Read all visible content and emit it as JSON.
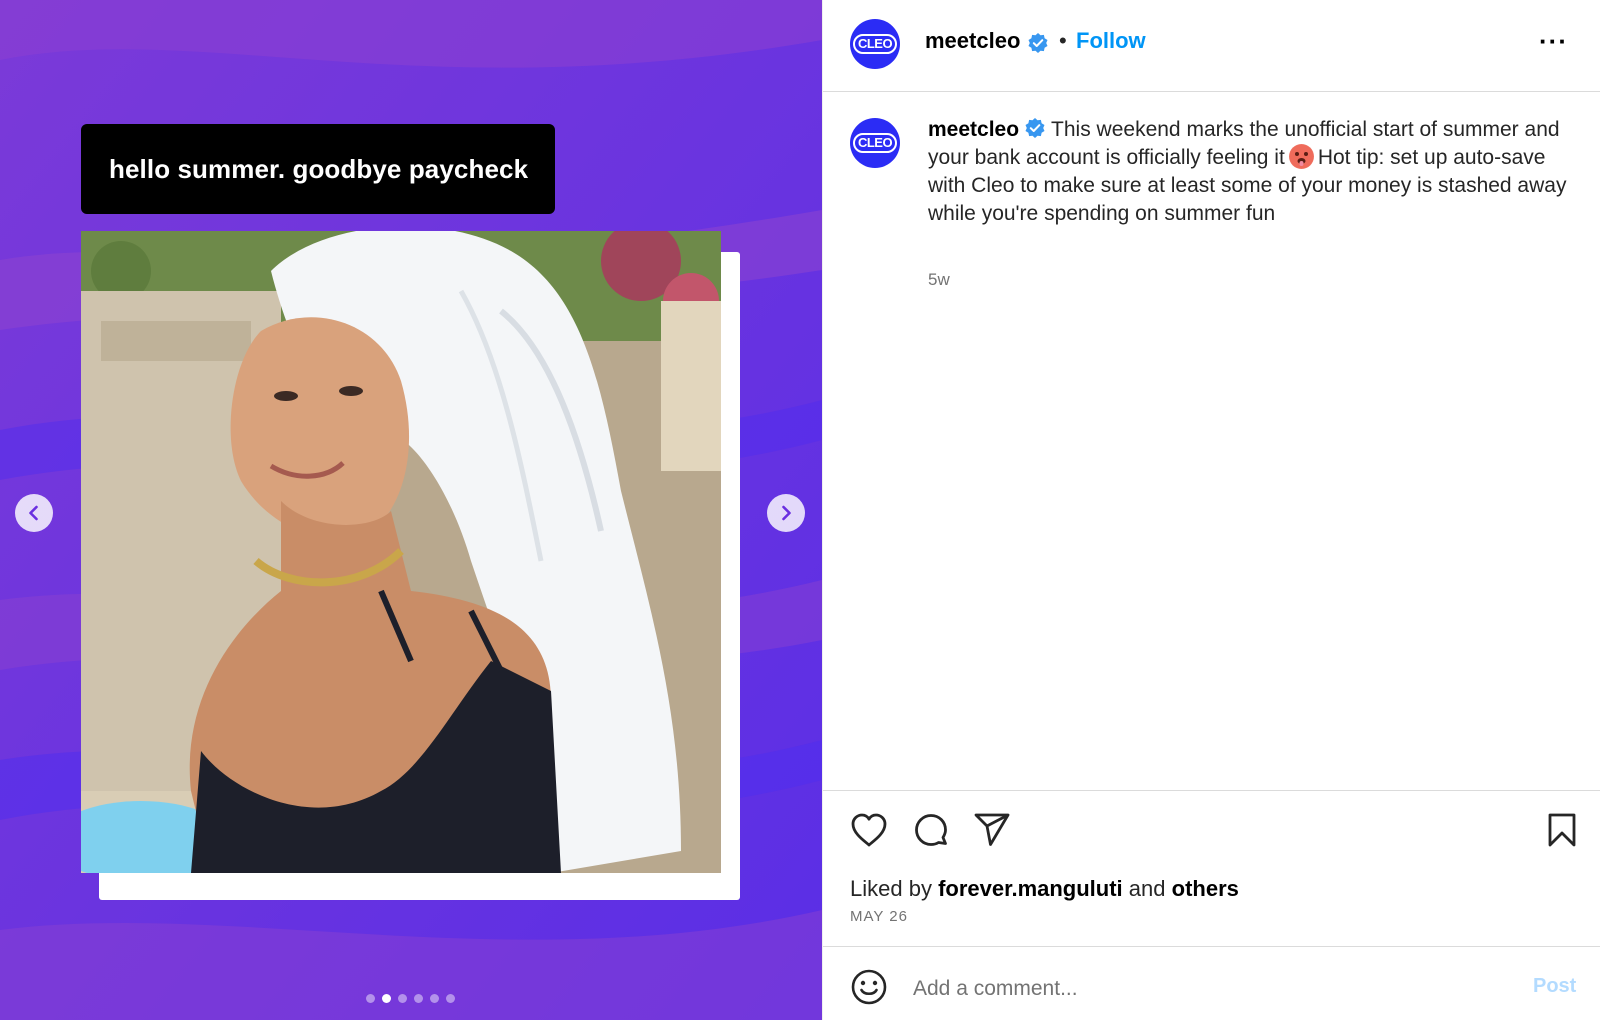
{
  "media": {
    "caption": "hello summer. goodbye paycheck",
    "carousel": {
      "total": 6,
      "active_index": 1
    },
    "colors": {
      "background": "#6a2fe0",
      "caption_bg": "#000000"
    }
  },
  "header": {
    "avatar_text": "CLEO",
    "username": "meetcleo",
    "separator": "•",
    "follow_label": "Follow",
    "more_label": "···"
  },
  "post": {
    "avatar_text": "CLEO",
    "username": "meetcleo",
    "text_part1": "This weekend marks the unofficial start of summer and your bank account is officially feeling it",
    "text_part2": "Hot tip: set up auto-save with Cleo to make sure at least some of your money is stashed away while you're spending on summer fun",
    "emoji": "hot-face-emoji",
    "time": "5w"
  },
  "actions": {
    "icons": [
      "heart-icon",
      "comment-icon",
      "share-icon",
      "bookmark-icon"
    ]
  },
  "likes": {
    "prefix": "Liked by",
    "user": "forever.manguluti",
    "connector": "and",
    "others": "others"
  },
  "date": "MAY 26",
  "comment": {
    "placeholder": "Add a comment...",
    "post_label": "Post"
  },
  "colors": {
    "accent": "#0095f6",
    "brand": "#2b2cf5",
    "post_disabled": "#b3dbff"
  }
}
